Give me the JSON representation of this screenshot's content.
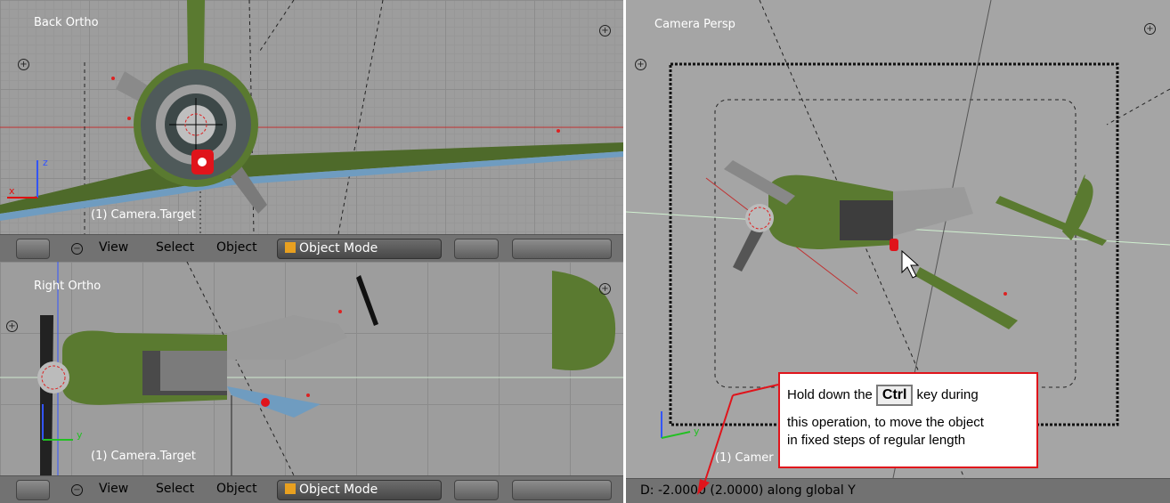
{
  "viewports": {
    "back": {
      "title": "Back Ortho",
      "object_label": "(1) Camera.Target"
    },
    "right": {
      "title": "Right Ortho",
      "object_label": "(1) Camera.Target"
    },
    "camera": {
      "title": "Camera Persp",
      "object_label": "(1) Camer"
    }
  },
  "header_menu": {
    "view": "View",
    "select": "Select",
    "object": "Object",
    "mode": "Object Mode"
  },
  "status": {
    "text": "D: -2.0000 (2.0000) along global Y"
  },
  "callout": {
    "pre_key": "Hold down the",
    "key": "Ctrl",
    "post_key": "key during",
    "line2": "this operation, to move the object",
    "line3": "in fixed steps of regular length"
  },
  "colors": {
    "accent_red": "#e0141b",
    "grid_bg": "#9d9d9d",
    "header_bg": "#727272"
  }
}
